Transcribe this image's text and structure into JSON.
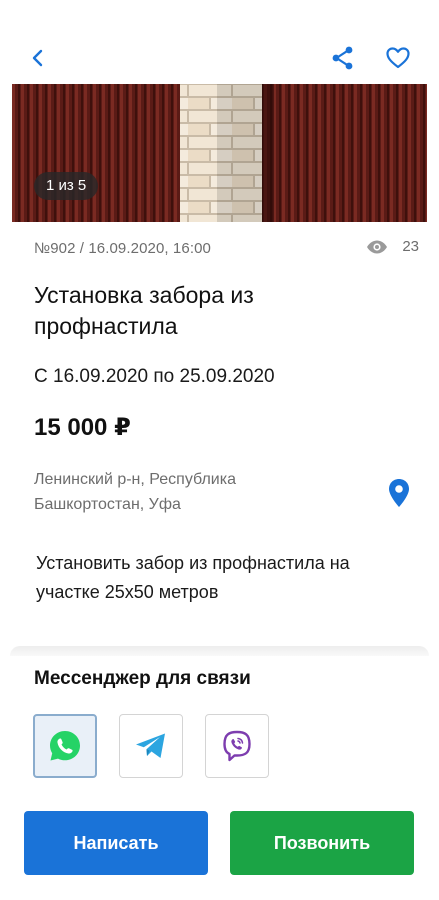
{
  "header": {
    "back_icon": "chevron-left-icon",
    "share_icon": "share-icon",
    "favorite_icon": "heart-outline-icon",
    "accent_color": "#1a73d8"
  },
  "gallery": {
    "counter": "1 из 5"
  },
  "listing": {
    "meta": "№902 / 16.09.2020, 16:00",
    "views": "23",
    "views_icon": "eye-icon",
    "title": "Установка забора из профнастила",
    "dates": "С 16.09.2020 по 25.09.2020",
    "price": "15 000 ₽",
    "address": "Ленинский р-н, Республика Башкортостан, Уфа",
    "location_icon": "map-pin-icon",
    "description": "Установить забор из профнастила на участке 25х50 метров"
  },
  "messengers": {
    "title": "Мессенджер для связи",
    "items": [
      {
        "icon": "whatsapp-icon",
        "selected": true,
        "color": "#25d366"
      },
      {
        "icon": "telegram-icon",
        "selected": false,
        "color": "#2ca5e0"
      },
      {
        "icon": "viber-icon",
        "selected": false,
        "color": "#7d3daf"
      }
    ]
  },
  "actions": {
    "write_label": "Написать",
    "call_label": "Позвонить",
    "write_color": "#1a73d8",
    "call_color": "#1ba445"
  }
}
